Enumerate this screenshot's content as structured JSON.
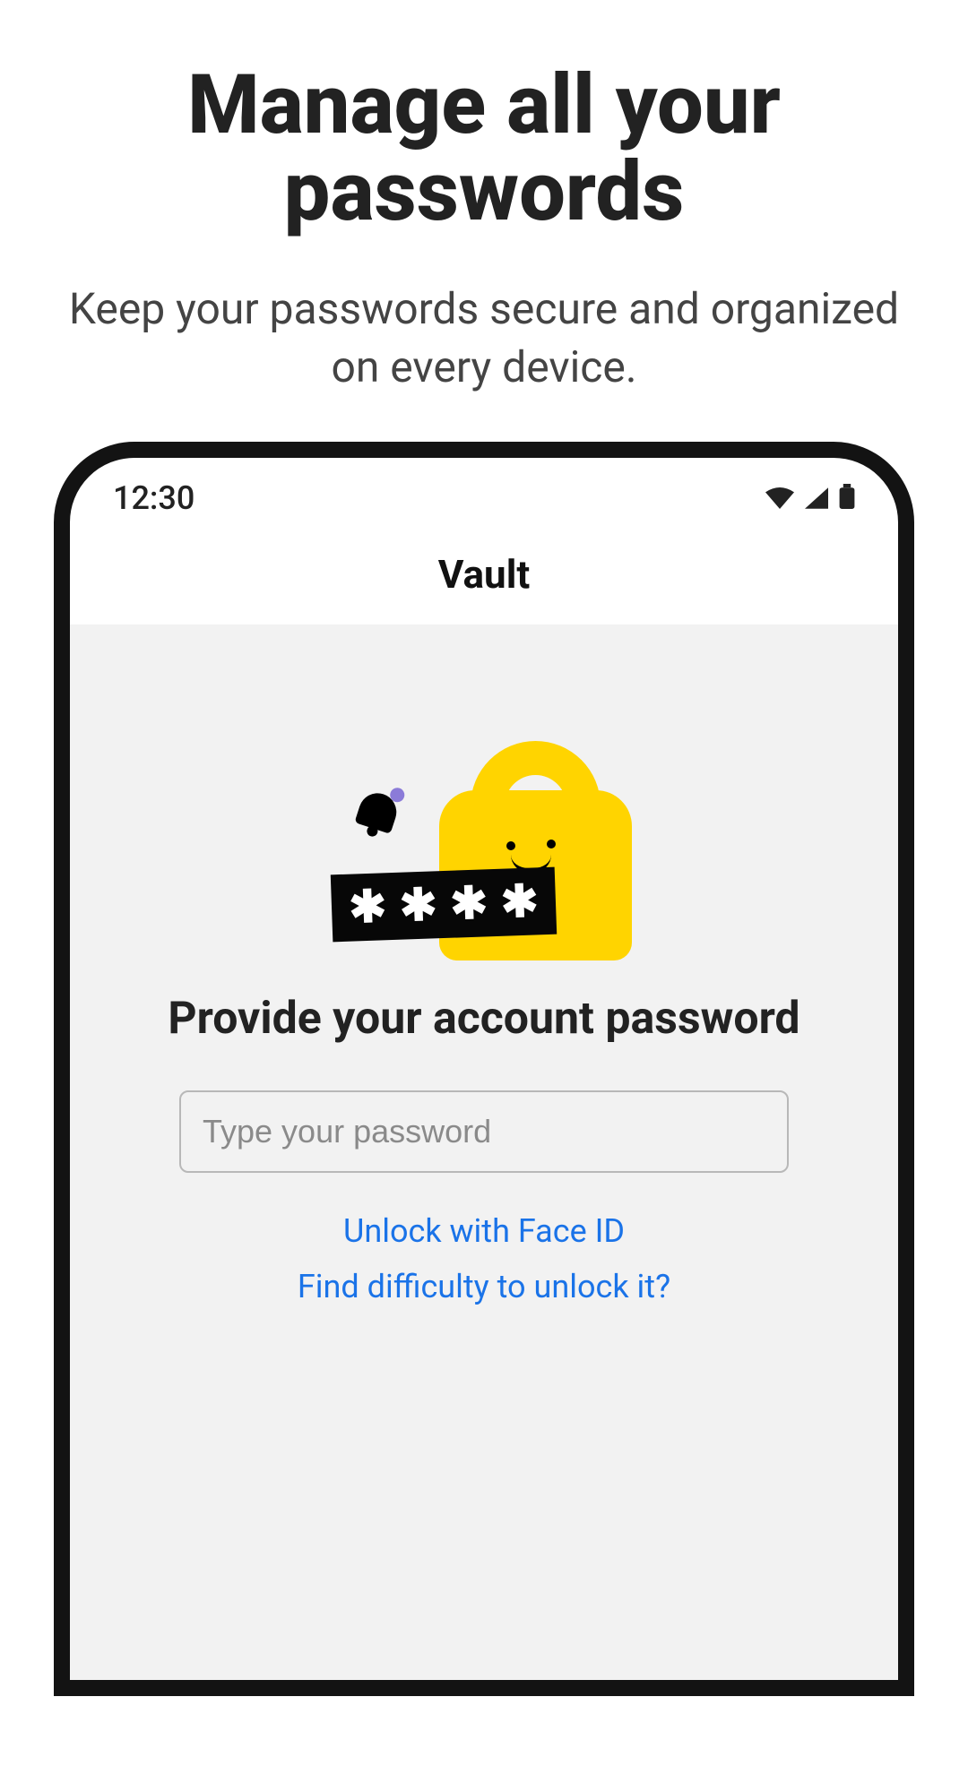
{
  "marketing": {
    "title": "Manage all your passwords",
    "subtitle": "Keep your passwords secure and organized on every device."
  },
  "statusbar": {
    "time": "12:30"
  },
  "app": {
    "header_title": "Vault",
    "heading": "Provide your account password",
    "password_placeholder": "Type your password",
    "face_id_link": "Unlock with Face ID",
    "help_link": "Find difficulty to unlock it?"
  },
  "colors": {
    "accent_yellow": "#ffd400",
    "link_blue": "#1a73e8",
    "bell_dot": "#8b7bd8"
  }
}
